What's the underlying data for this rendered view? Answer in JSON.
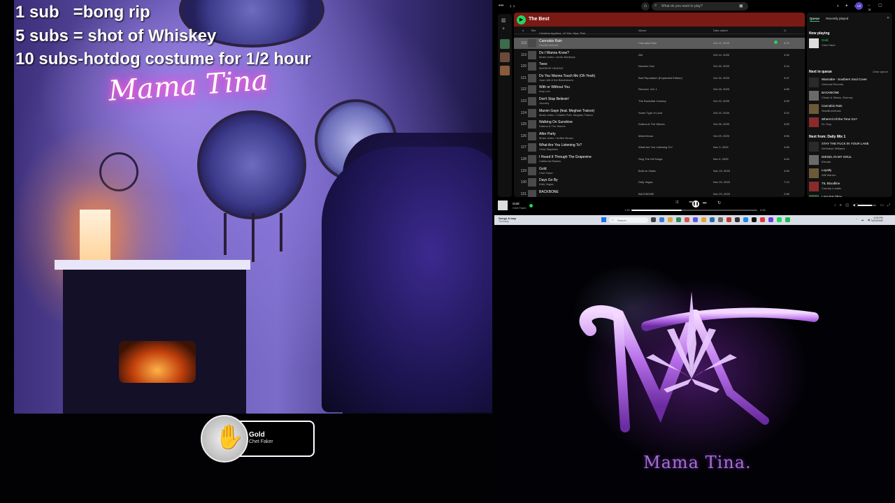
{
  "overlay": {
    "line1": "1 sub   =bong rip",
    "line2": "5 subs = shot of Whiskey",
    "line3": "10 subs-hotdog costume for 1/2 hour"
  },
  "webcam": {
    "neon_sign": "Mama Tina"
  },
  "now_playing_widget": {
    "title": "Gold",
    "artist": "Chet Faker"
  },
  "spotify": {
    "search_placeholder": "What do you want to play?",
    "avatar_initials": "CE",
    "playlist_title": "The Best",
    "columns": {
      "num": "#",
      "title": "Title",
      "album": "Album",
      "date": "Date added"
    },
    "partial_top_row": "Christina Aguilera, Lil' Kim, Mya, Pink",
    "rows": [
      {
        "num": "118",
        "title": "Cannabis Rain",
        "artist": "SlowBurnMusik",
        "album": "Cannabis Rain",
        "date": "Oct 12, 2025",
        "dur": "3:19",
        "active": true
      },
      {
        "num": "119",
        "title": "Do I Wanna Know?",
        "artist": "Music video • Arctic Monkeys",
        "album": "AM",
        "date": "Oct 14, 2025",
        "dur": "4:32"
      },
      {
        "num": "120",
        "title": "Twos",
        "artist": "MASSIVE HASSLE",
        "album": "Number One",
        "date": "Oct 15, 2025",
        "dur": "4:14"
      },
      {
        "num": "121",
        "title": "Do You Wanna Touch Me (Oh Yeah)",
        "artist": "Joan Jett & the Blackhearts",
        "album": "Bad Reputation (Expanded Edition)",
        "date": "Oct 16, 2025",
        "dur": "3:47"
      },
      {
        "num": "122",
        "title": "With or Without You",
        "artist": "Amy Lee",
        "album": "Recover, Vol. 1",
        "date": "Oct 18, 2025",
        "dur": "4:06"
      },
      {
        "num": "123",
        "title": "Don't Stop Believin'",
        "artist": "Journey",
        "album": "The Essential Journey",
        "date": "Oct 19, 2025",
        "dur": "4:09"
      },
      {
        "num": "124",
        "title": "Marvin Gaye (feat. Meghan Trainor)",
        "artist": "Music video • Charlie Puth, Meghan Trainor",
        "album": "Some Type of Love",
        "date": "Oct 22, 2025",
        "dur": "3:10"
      },
      {
        "num": "125",
        "title": "Walking On Sunshine",
        "artist": "Katrina & The Waves",
        "album": "Katrina & The Waves",
        "date": "Oct 26, 2025",
        "dur": "3:59"
      },
      {
        "num": "126",
        "title": "After Party",
        "artist": "Music video • Koffee Brown",
        "album": "Mars/Venus",
        "date": "Oct 29, 2025",
        "dur": "3:55"
      },
      {
        "num": "127",
        "title": "What Are You Listening To?",
        "artist": "Chris Stapleton",
        "album": "What Are You Listening To?",
        "date": "Nov 3, 2025",
        "dur": "4:06"
      },
      {
        "num": "128",
        "title": "I Heard It Through The Grapevine",
        "artist": "California Raisins",
        "album": "Sing The Hit Songs",
        "date": "Nov 6, 2025",
        "dur": "3:44"
      },
      {
        "num": "129",
        "title": "Gold",
        "artist": "Chet Faker",
        "album": "Built on Glass",
        "date": "Nov 19, 2025",
        "dur": "4:45"
      },
      {
        "num": "130",
        "title": "Days Go By",
        "artist": "Dirty Vegas",
        "album": "Dirty Vegas",
        "date": "Nov 20, 2025",
        "dur": "7:13"
      },
      {
        "num": "131",
        "title": "BACKBONE",
        "artist": "",
        "album": "BACKBONE",
        "date": "Nov 23, 2025",
        "dur": "2:58"
      }
    ],
    "queue": {
      "tab_queue": "Queue",
      "tab_recent": "Recently played",
      "now_playing_label": "Now playing",
      "now_playing": {
        "title": "Gold",
        "artist": "Chet Faker"
      },
      "next_label": "Next in queue",
      "clear": "Clear queue",
      "next": [
        {
          "title": "Wannabe - Southern Soul Cover",
          "artist": "Unfound Records"
        },
        {
          "title": "BACKBONE",
          "artist": "Chase & Status, Stormzy"
        },
        {
          "title": "Cannabis Rain",
          "artist": "SlowBurnMusik"
        },
        {
          "title": "Where'd All the Time Go?",
          "artist": "Dr. Dog"
        }
      ],
      "from_label": "Next from: Daily Mix 1",
      "from": [
        {
          "title": "STAY THE FUCK IN YOUR LANE",
          "artist": "DeShawn Williams"
        },
        {
          "title": "DIESEL IN MY SOUL",
          "artist": "Elevate"
        },
        {
          "title": "Loyalty",
          "artist": "Will Warren"
        },
        {
          "title": "TIL Bloodline",
          "artist": "Country Lunatic"
        },
        {
          "title": "I Am Not Okay",
          "artist": "Jelly Roll"
        }
      ]
    },
    "player": {
      "track": "Gold",
      "artist": "Chet Faker",
      "elapsed": "1:55",
      "total": "4:45",
      "progress": 0.4,
      "volume": 0.75
    }
  },
  "taskbar": {
    "weather_line1": "Songs & trap",
    "weather_line2": "Thursday",
    "search": "Search",
    "time": "5:03 PM",
    "date": "4/24/2025"
  },
  "logo": {
    "name": "Mama Tina."
  },
  "colors": {
    "spotify_green": "#1ed760",
    "header_red": "#7a1a14",
    "logo_purple": "#b070e0"
  }
}
